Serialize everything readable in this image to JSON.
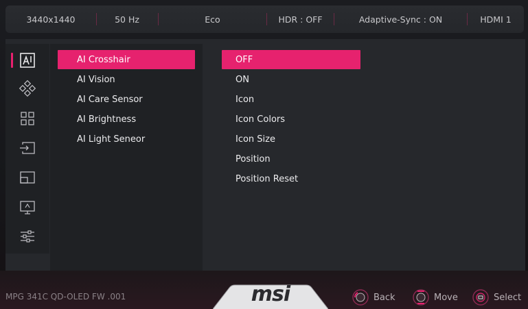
{
  "status_bar": {
    "resolution": "3440x1440",
    "refresh": "50 Hz",
    "mode": "Eco",
    "hdr": "HDR : OFF",
    "adaptive_sync": "Adaptive-Sync : ON",
    "input": "HDMI 1"
  },
  "sidebar": {
    "icons": [
      {
        "name": "ai-icon",
        "active": true
      },
      {
        "name": "gaming-icon",
        "active": false
      },
      {
        "name": "professional-icon",
        "active": false
      },
      {
        "name": "input-source-icon",
        "active": false
      },
      {
        "name": "pip-pbp-icon",
        "active": false
      },
      {
        "name": "image-icon",
        "active": false
      },
      {
        "name": "settings-icon",
        "active": false
      }
    ]
  },
  "menu": {
    "items": [
      "AI Crosshair",
      "AI Vision",
      "AI Care Sensor",
      "AI Brightness",
      "AI Light Seneor"
    ],
    "selected_index": 0
  },
  "submenu": {
    "items": [
      "OFF",
      "ON",
      "Icon",
      "Icon Colors",
      "Icon Size",
      "Position",
      "Position Reset"
    ],
    "selected_index": 0
  },
  "footer": {
    "model": "MPG 341C QD-OLED  FW .001",
    "logo": "msi",
    "back_label": "Back",
    "move_label": "Move",
    "select_label": "Select"
  },
  "colors": {
    "accent": "#e6226e",
    "background": "#26282c"
  }
}
